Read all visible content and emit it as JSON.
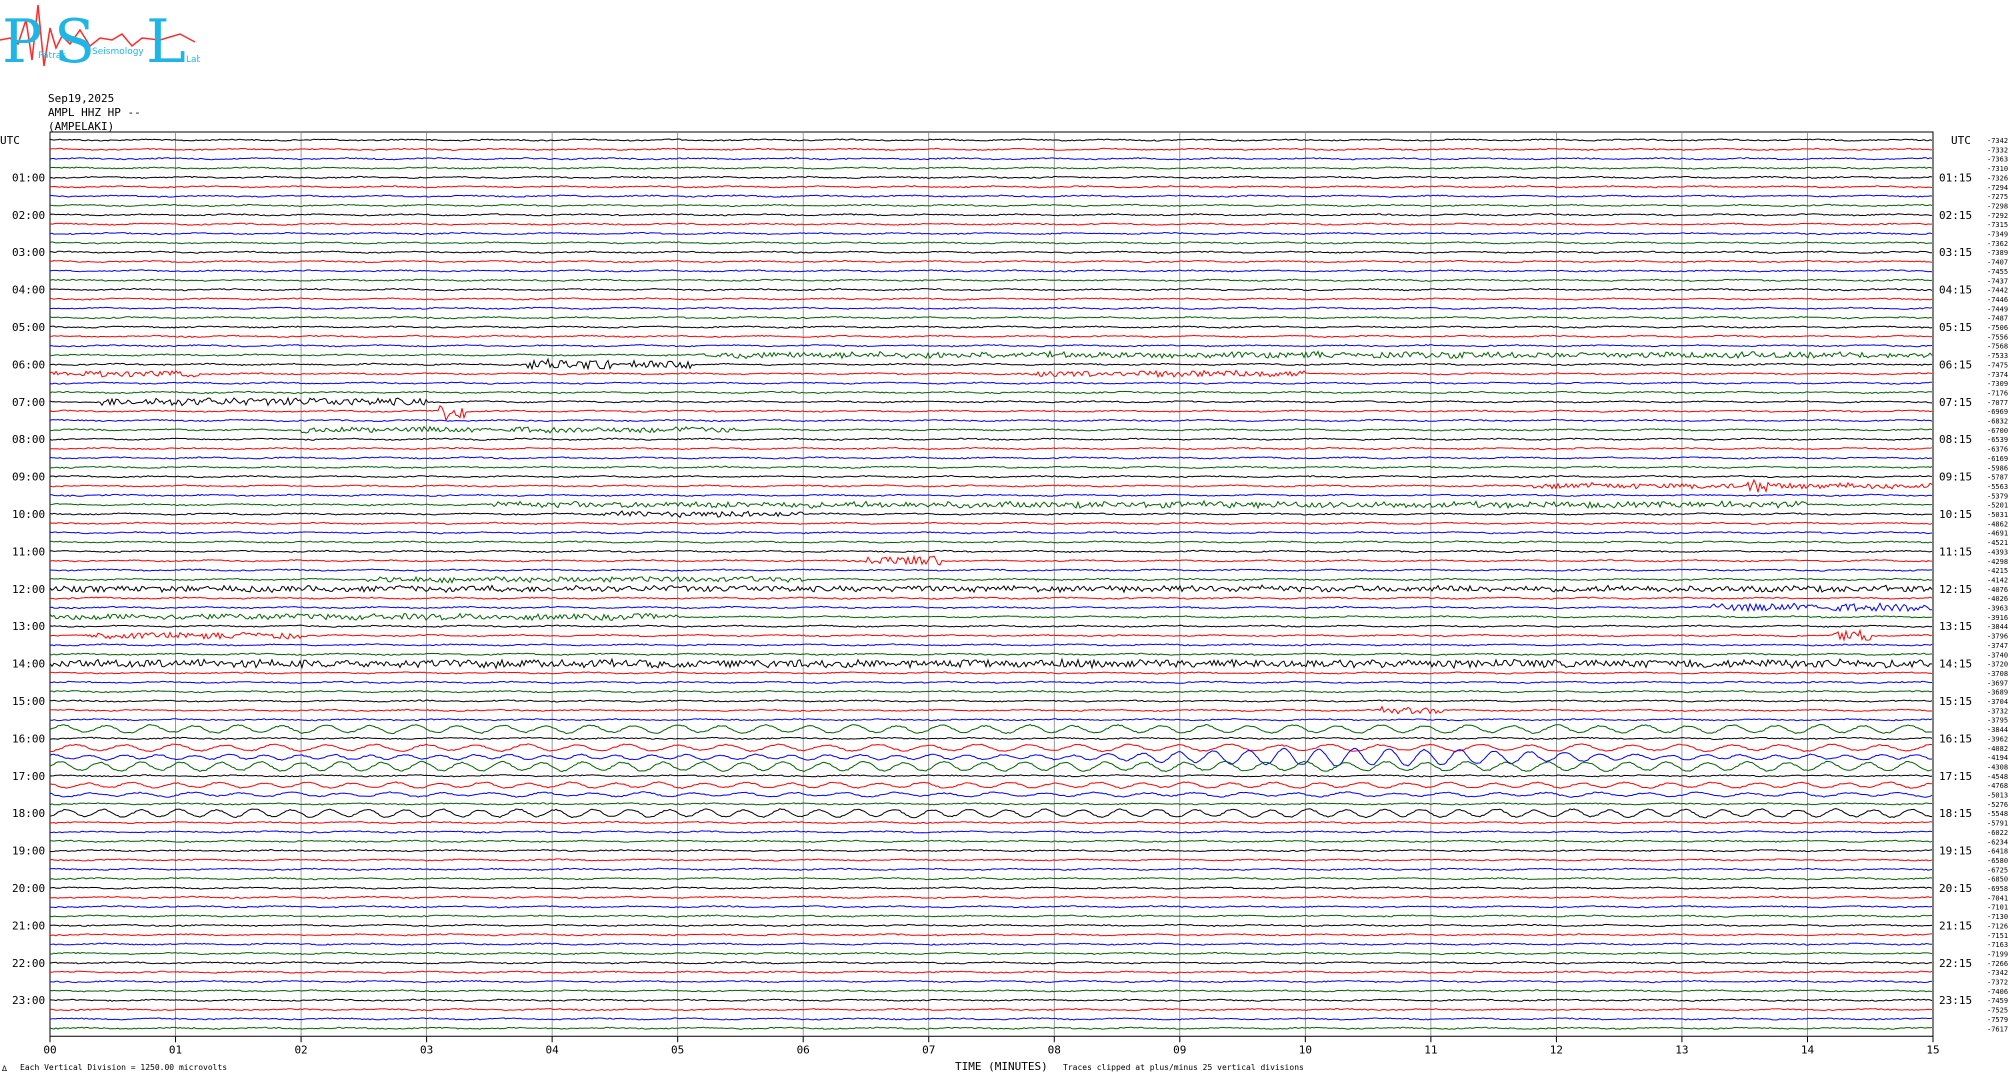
{
  "header": {
    "logo_letters": [
      "P",
      "S",
      "L"
    ],
    "logo_subtext": [
      "Patras",
      "Seismology",
      "Lab"
    ],
    "date": "Sep19,2025",
    "channel": "AMPL HHZ HP --",
    "station": "(AMPELAKI)"
  },
  "colors": {
    "trace_cycle": [
      "#000000",
      "#ff0000",
      "#0000ff",
      "#006400"
    ],
    "grid": "#808080",
    "logo_cyan": "#1fb6e6",
    "logo_red": "#ff2a2a"
  },
  "chart_data": {
    "type": "line",
    "left_axis_label": "UTC",
    "right_axis_label": "UTC",
    "left_hour_labels": [
      "01:00",
      "02:00",
      "03:00",
      "04:00",
      "05:00",
      "06:00",
      "07:00",
      "08:00",
      "09:00",
      "10:00",
      "11:00",
      "12:00",
      "13:00",
      "14:00",
      "15:00",
      "16:00",
      "17:00",
      "18:00",
      "19:00",
      "20:00",
      "21:00",
      "22:00",
      "23:00"
    ],
    "right_hour_labels": [
      "01:15",
      "02:15",
      "03:15",
      "04:15",
      "05:15",
      "06:15",
      "07:15",
      "08:15",
      "09:15",
      "10:15",
      "11:15",
      "12:15",
      "13:15",
      "14:15",
      "15:15",
      "16:15",
      "17:15",
      "18:15",
      "19:15",
      "20:15",
      "21:15",
      "22:15",
      "23:15"
    ],
    "trace_offsets": [
      "-7342",
      "-7332",
      "-7363",
      "-7310",
      "-7326",
      "-7294",
      "-7275",
      "-7298",
      "-7292",
      "-7315",
      "-7349",
      "-7362",
      "-7389",
      "-7407",
      "-7455",
      "-7437",
      "-7442",
      "-7446",
      "-7449",
      "-7487",
      "-7506",
      "-7556",
      "-7568",
      "-7533",
      "-7475",
      "-7374",
      "-7309",
      "-7176",
      "-7077",
      "-6969",
      "-6832",
      "-6700",
      "-6539",
      "-6376",
      "-6169",
      "-5986",
      "-5787",
      "-5563",
      "-5379",
      "-5201",
      "-5031",
      "-4862",
      "-4691",
      "-4521",
      "-4393",
      "-4298",
      "-4215",
      "-4142",
      "-4076",
      "-4026",
      "-3963",
      "-3916",
      "-3844",
      "-3796",
      "-3747",
      "-3740",
      "-3720",
      "-3708",
      "-3697",
      "-3689",
      "-3704",
      "-3732",
      "-3795",
      "-3844",
      "-3962",
      "-4082",
      "-4194",
      "-4308",
      "-4548",
      "-4768",
      "-5013",
      "-5276",
      "-5548",
      "-5791",
      "-6022",
      "-6234",
      "-6418",
      "-6580",
      "-6725",
      "-6850",
      "-6958",
      "-7041",
      "-7101",
      "-7130",
      "-7126",
      "-7151",
      "-7163",
      "-7199",
      "-7266",
      "-7342",
      "-7372",
      "-7406",
      "-7459",
      "-7525",
      "-7579",
      "-7617"
    ],
    "x_ticks": [
      "00",
      "01",
      "02",
      "03",
      "04",
      "05",
      "06",
      "07",
      "08",
      "09",
      "10",
      "11",
      "12",
      "13",
      "14",
      "15"
    ],
    "x_range": [
      0,
      15
    ],
    "xlabel": "TIME (MINUTES)",
    "traces_per_hour": 4,
    "trace_count": 96,
    "minutes_per_trace": 15,
    "grid": true,
    "events": [
      {
        "trace": 24,
        "minute_start": 3.8,
        "minute_end": 4.5,
        "amp": 1.6
      },
      {
        "trace": 24,
        "minute_start": 4.6,
        "minute_end": 5.1,
        "amp": 1.2
      },
      {
        "trace": 23,
        "minute_start": 5.2,
        "minute_end": 15,
        "amp": 0.9
      },
      {
        "trace": 25,
        "minute_start": 0.0,
        "minute_end": 1.2,
        "amp": 0.9
      },
      {
        "trace": 25,
        "minute_start": 7.8,
        "minute_end": 10.0,
        "amp": 1.0
      },
      {
        "trace": 28,
        "minute_start": 0.4,
        "minute_end": 3.0,
        "amp": 1.2
      },
      {
        "trace": 29,
        "minute_start": 3.1,
        "minute_end": 3.3,
        "amp": 3.0
      },
      {
        "trace": 31,
        "minute_start": 2.0,
        "minute_end": 5.5,
        "amp": 0.8
      },
      {
        "trace": 37,
        "minute_start": 11.8,
        "minute_end": 15,
        "amp": 0.8
      },
      {
        "trace": 37,
        "minute_start": 13.5,
        "minute_end": 13.7,
        "amp": 2.5
      },
      {
        "trace": 40,
        "minute_start": 4.4,
        "minute_end": 6.0,
        "amp": 0.9
      },
      {
        "trace": 39,
        "minute_start": 3.5,
        "minute_end": 14.0,
        "amp": 0.9
      },
      {
        "trace": 45,
        "minute_start": 6.5,
        "minute_end": 7.1,
        "amp": 1.5
      },
      {
        "trace": 48,
        "minute_start": 0.0,
        "minute_end": 15,
        "amp": 0.9
      },
      {
        "trace": 47,
        "minute_start": 2.5,
        "minute_end": 6.0,
        "amp": 0.8
      },
      {
        "trace": 50,
        "minute_start": 13.2,
        "minute_end": 15,
        "amp": 1.2
      },
      {
        "trace": 51,
        "minute_start": 0.0,
        "minute_end": 5.0,
        "amp": 0.9
      },
      {
        "trace": 53,
        "minute_start": 0.3,
        "minute_end": 2.0,
        "amp": 0.9
      },
      {
        "trace": 53,
        "minute_start": 14.2,
        "minute_end": 14.5,
        "amp": 1.8
      },
      {
        "trace": 56,
        "minute_start": 0.0,
        "minute_end": 15,
        "amp": 1.2
      },
      {
        "trace": 61,
        "minute_start": 10.6,
        "minute_end": 11.1,
        "amp": 1.0
      }
    ],
    "surface_waves": [
      {
        "trace": 63,
        "amp": 1.2,
        "period_min": 0.35
      },
      {
        "trace": 65,
        "amp": 1.0,
        "period_min": 0.4
      },
      {
        "trace": 66,
        "amp": 2.8,
        "period_min": 0.28,
        "peak_minute": 10.4
      },
      {
        "trace": 67,
        "amp": 1.4,
        "period_min": 0.32
      },
      {
        "trace": 69,
        "amp": 0.8,
        "period_min": 0.35
      },
      {
        "trace": 70,
        "amp": 0.6,
        "period_min": 0.4
      },
      {
        "trace": 72,
        "amp": 1.2,
        "period_min": 0.3
      }
    ]
  },
  "footer": {
    "left_note": "Each Vertical Division = 1250.00 microvolts",
    "right_note": "Traces clipped at plus/minus 25 vertical divisions",
    "corner_mark": "∆"
  }
}
